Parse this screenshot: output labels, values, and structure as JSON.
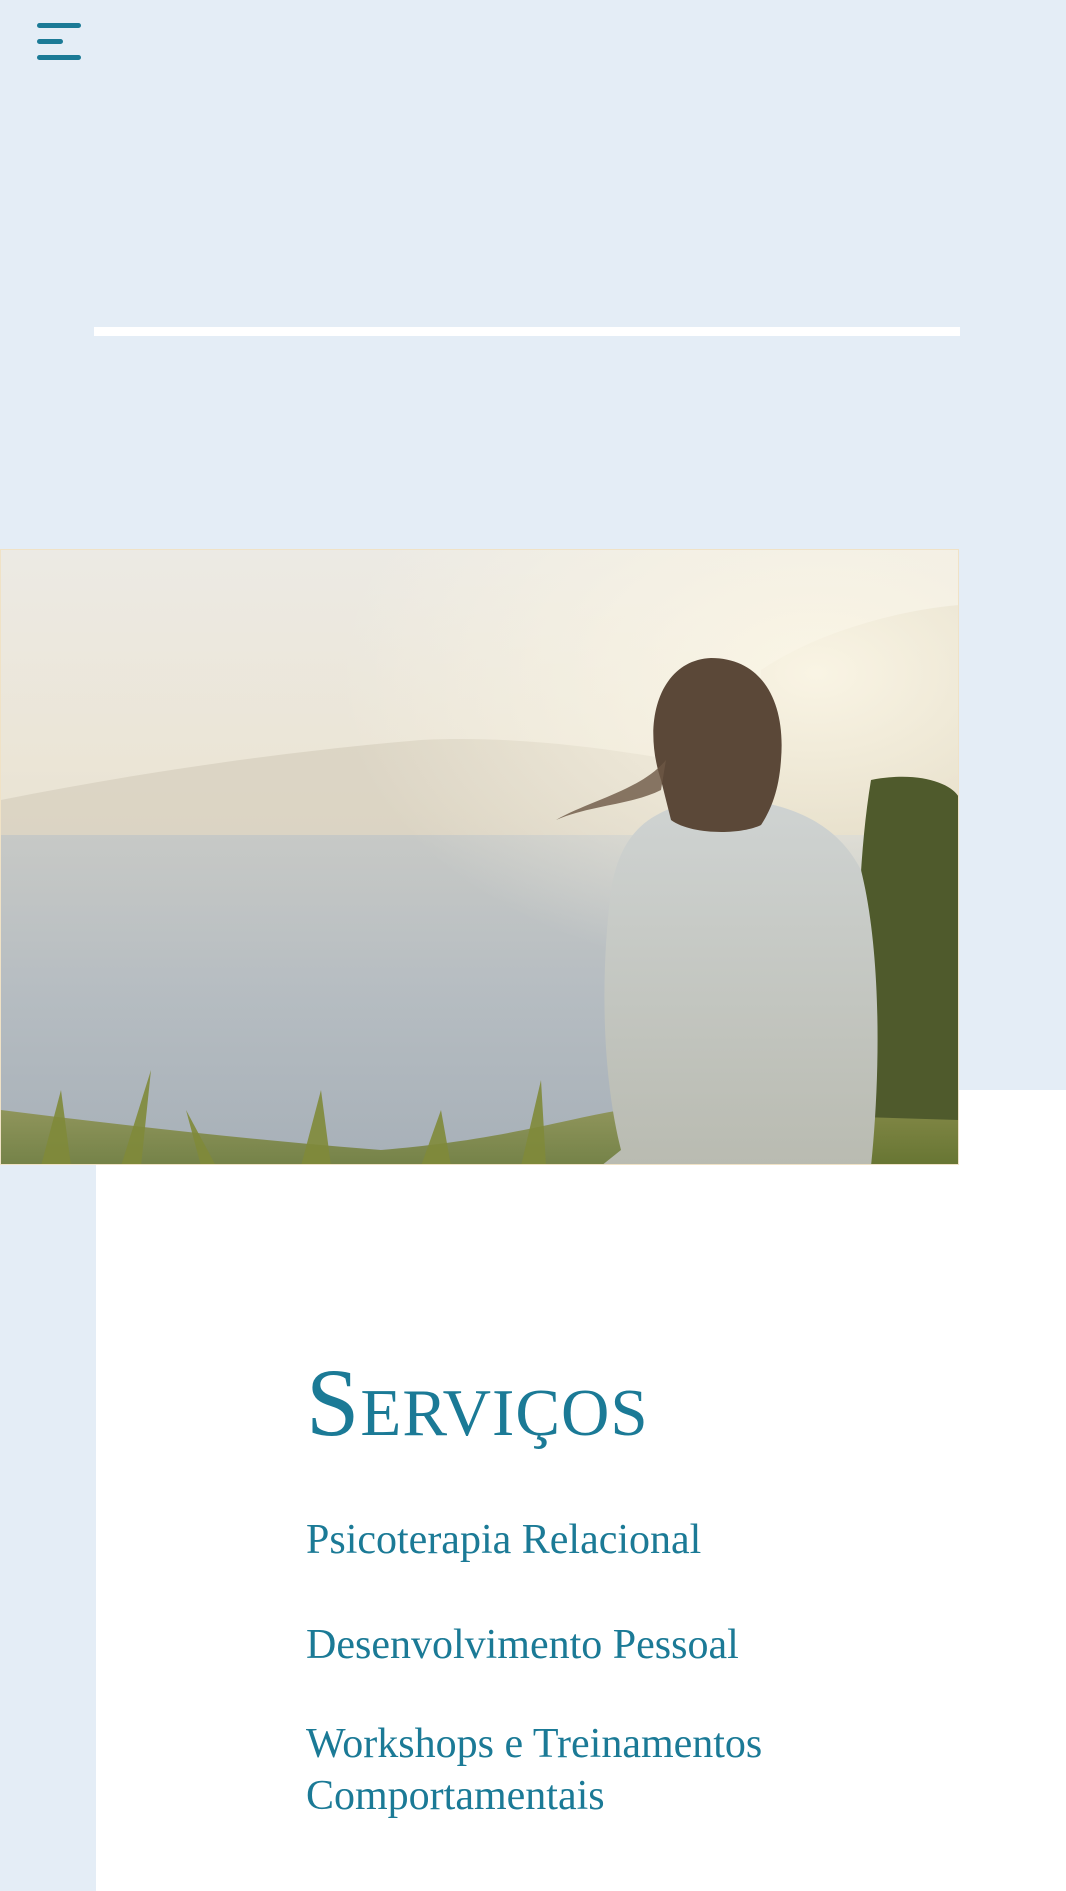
{
  "header": {
    "menu_icon": "hamburger-menu-icon"
  },
  "hero": {
    "image_description_icon": "photo-woman-by-sea"
  },
  "services": {
    "title": "Serviços",
    "items": [
      "Psicoterapia Relacional",
      "Desenvolvimento Pessoal",
      "Workshops e Treinamentos Comportamentais"
    ]
  },
  "colors": {
    "background": "#e4edf6",
    "accent": "#1b7a96",
    "panel": "#ffffff"
  }
}
